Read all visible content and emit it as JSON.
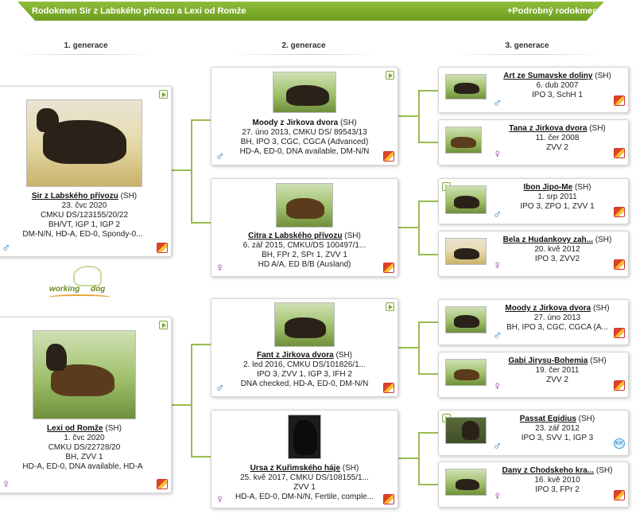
{
  "header": {
    "title": "Rodokmen Sir z Labského přívozu a Lexi od Romže",
    "detail_link": "+Podrobný rodokmen"
  },
  "generations": [
    "1. generace",
    "2. generace",
    "3. generace"
  ],
  "logo": {
    "word1": "working",
    "word2": "dog"
  },
  "icons": {
    "play": "play-video-icon",
    "male": "♂",
    "female": "♀",
    "badge": "kennel-flag-icon",
    "kk": "KK"
  },
  "colors": {
    "accent": "#7aa82a",
    "male": "#1d6fb0",
    "female": "#8a2a9a"
  },
  "gen1": [
    {
      "name": "Sir z Labského přívozu",
      "breed": "(SH)",
      "sex": "♂",
      "lines": [
        "23. čvc 2020",
        "CMKU DS/123155/20/22",
        "BH/VT, IGP 1, IGP 2",
        "DM-N/N, HD-A, ED-0, Spondy-0..."
      ]
    },
    {
      "name": "Lexi od Romže",
      "breed": "(SH)",
      "sex": "♀",
      "lines": [
        "1. čvc 2020",
        "CMKU DS/22728/20",
        "BH, ZVV 1",
        "HD-A, ED-0, DNA available, HD-A"
      ]
    }
  ],
  "gen2": [
    {
      "name": "Moody z Jirkova dvora",
      "breed": "(SH)",
      "sex": "♂",
      "lines": [
        "27. úno 2013, CMKU DS/ 89543/13",
        "BH, IPO 3, CGC, CGCA (Advanced)",
        "HD-A, ED-0, DNA available, DM-N/N"
      ]
    },
    {
      "name": "Citra z Labského přívozu",
      "breed": "(SH)",
      "sex": "♀",
      "lines": [
        "6. zář 2015, CMKU/DS 100497/1...",
        "BH, FPr 2, SPr 1, ZVV 1",
        "HD A/A, ED B/B (Ausland)"
      ]
    },
    {
      "name": "Fant z Jirkova dvora",
      "breed": "(SH)",
      "sex": "♂",
      "lines": [
        "2. led 2016, CMKU DS/101826/1...",
        "IPO 3, ZVV 1, IGP 3, IFH 2",
        "DNA checked, HD-A, ED-0, DM-N/N"
      ]
    },
    {
      "name": "Ursa z Kuřimského háje",
      "breed": "(SH)",
      "sex": "♀",
      "lines": [
        "25. kvě 2017, CMKU DS/108155/1...",
        "ZVV 1",
        "HD-A, ED-0, DM-N/N, Fertile, comple..."
      ]
    }
  ],
  "gen3": [
    {
      "name": "Art ze Sumavske doliny",
      "breed": "(SH)",
      "sex": "♂",
      "lines": [
        "6. dub 2007",
        "IPO 3, SchH 1"
      ]
    },
    {
      "name": "Tana z Jirkova dvora",
      "breed": "(SH)",
      "sex": "♀",
      "lines": [
        "11. čer 2008",
        "ZVV 2"
      ]
    },
    {
      "name": "Ibon Jipo-Me",
      "breed": "(SH)",
      "sex": "♂",
      "lines": [
        "1. srp 2011",
        "IPO 3, ZPO 1, ZVV 1"
      ]
    },
    {
      "name": "Bela z Hudankovy zah...",
      "breed": "(SH)",
      "sex": "♀",
      "lines": [
        "20. kvě 2012",
        "IPO 3, ZVV2"
      ]
    },
    {
      "name": "Moody z Jirkova dvora",
      "breed": "(SH)",
      "sex": "♂",
      "lines": [
        "27. úno 2013",
        "BH, IPO 3, CGC, CGCA (A..."
      ]
    },
    {
      "name": "Gabi Jirysu-Bohemia",
      "breed": "(SH)",
      "sex": "♀",
      "lines": [
        "19. čer 2011",
        "ZVV 2"
      ]
    },
    {
      "name": "Passat Egidius",
      "breed": "(SH)",
      "sex": "♂",
      "lines": [
        "23. zář 2012",
        "IPO 3, SVV 1, IGP 3"
      ]
    },
    {
      "name": "Dany z Chodskeho kra...",
      "breed": "(SH)",
      "sex": "♀",
      "lines": [
        "16. kvě 2010",
        "IPO 3, FPr 2"
      ]
    }
  ]
}
